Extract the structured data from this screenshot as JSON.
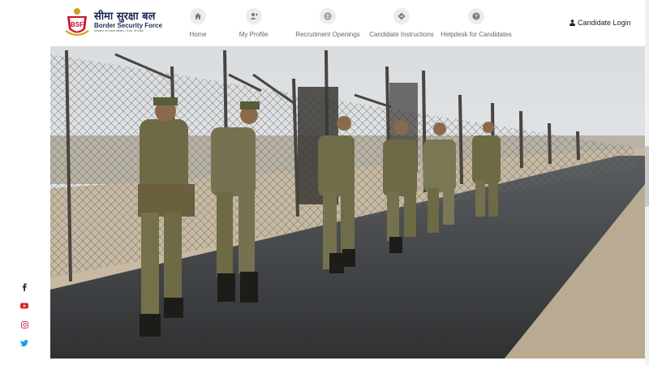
{
  "brand": {
    "hindi_name": "सीमा सुरक्षा बल",
    "english_name": "Border Security Force",
    "ministry": "Ministry of Home Affairs | Govt. of India",
    "logo_letters": "BSF"
  },
  "nav": {
    "items": [
      {
        "label": "Home",
        "icon": "home-icon"
      },
      {
        "label": "My Profile",
        "icon": "user-plus-icon"
      },
      {
        "label": "Recruitment Openings",
        "icon": "globe-icon"
      },
      {
        "label": "Candidate Instructions",
        "icon": "directions-icon"
      },
      {
        "label": "Helpdesk for Candidates",
        "icon": "question-icon"
      }
    ]
  },
  "login": {
    "label": "Candidate Login",
    "icon": "user-icon"
  },
  "hero": {
    "image": "soldiers-patrolling-border-fence"
  },
  "social": [
    "facebook-icon",
    "youtube-icon",
    "instagram-icon",
    "twitter-icon"
  ],
  "colors": {
    "brand_navy": "#1c2a55",
    "nav_icon_bg": "#ececec",
    "youtube_red": "#d62b2b"
  }
}
